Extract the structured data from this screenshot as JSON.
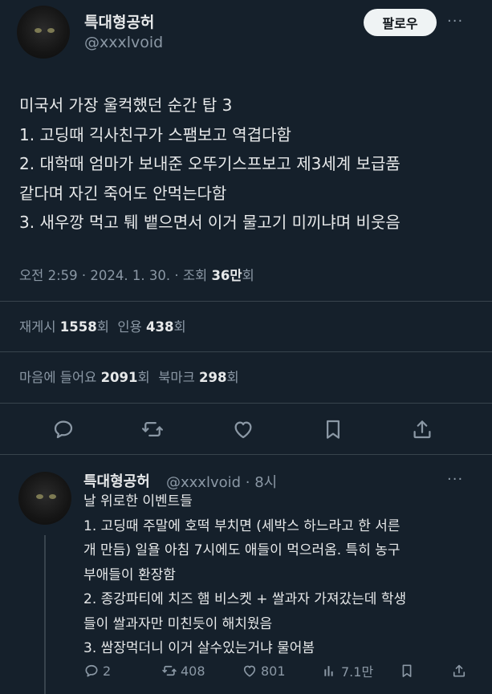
{
  "tweet": {
    "author_name": "특대형공허",
    "author_handle": "@xxxlvoid",
    "follow_label": "팔로우",
    "more_label": "···",
    "lines": [
      "미국서 가장 울컥했던 순간 탑 3",
      "1. 고딩때 긱사친구가 스팸보고 역겹다함",
      "2. 대학때 엄마가 보내준 오뚜기스프보고 제3세계 보급품",
      "같다며 자긴 죽어도 안먹는다함",
      "3. 새우깡 먹고 퉤 뱉으면서 이거 물고기 미끼냐며 비웃음"
    ],
    "timestamp": "오전 2:59 · 2024. 1. 30. · 조회 ",
    "views_count": "36만",
    "views_suffix": "회",
    "retweets_label": "재게시 ",
    "retweets_count": "1558",
    "retweets_suffix": "회",
    "quotes_label": "인용 ",
    "quotes_count": "438",
    "quotes_suffix": "회",
    "likes_label": "마음에 들어요 ",
    "likes_count": "2091",
    "likes_suffix": "회",
    "bookmarks_label": "북마크 ",
    "bookmarks_count": "298",
    "bookmarks_suffix": "회",
    "actions": [
      "reply-icon",
      "retweet-icon",
      "heart-icon",
      "bookmark-icon",
      "share-icon"
    ]
  },
  "reply": {
    "author_name": "특대형공허",
    "author_handle": "@xxxlvoid · 8시",
    "more_label": "···",
    "lines": [
      "날 위로한 이벤트들",
      "1. 고딩때 주말에 호떡 부치면 (세박스 하느라고 한 서른",
      "개 만듬) 일욜 아침 7시에도 애들이 먹으러옴. 특히 농구",
      "부애들이 환장함",
      "2. 종강파티에 치즈 햄 비스켓 + 쌀과자 가져갔는데 학생",
      "들이 쌀과자만 미친듯이 해치웠음",
      "3. 쌈장먹더니 이거 살수있는거냐 물어봄"
    ],
    "replies": "2",
    "retweets": "408",
    "likes": "801",
    "views": "7.1만"
  },
  "colors": {
    "background": "#15202b",
    "text": "#e7e9ea",
    "muted": "#8b98a5",
    "divider": "#38444d",
    "follow_bg": "#eff3f4"
  }
}
